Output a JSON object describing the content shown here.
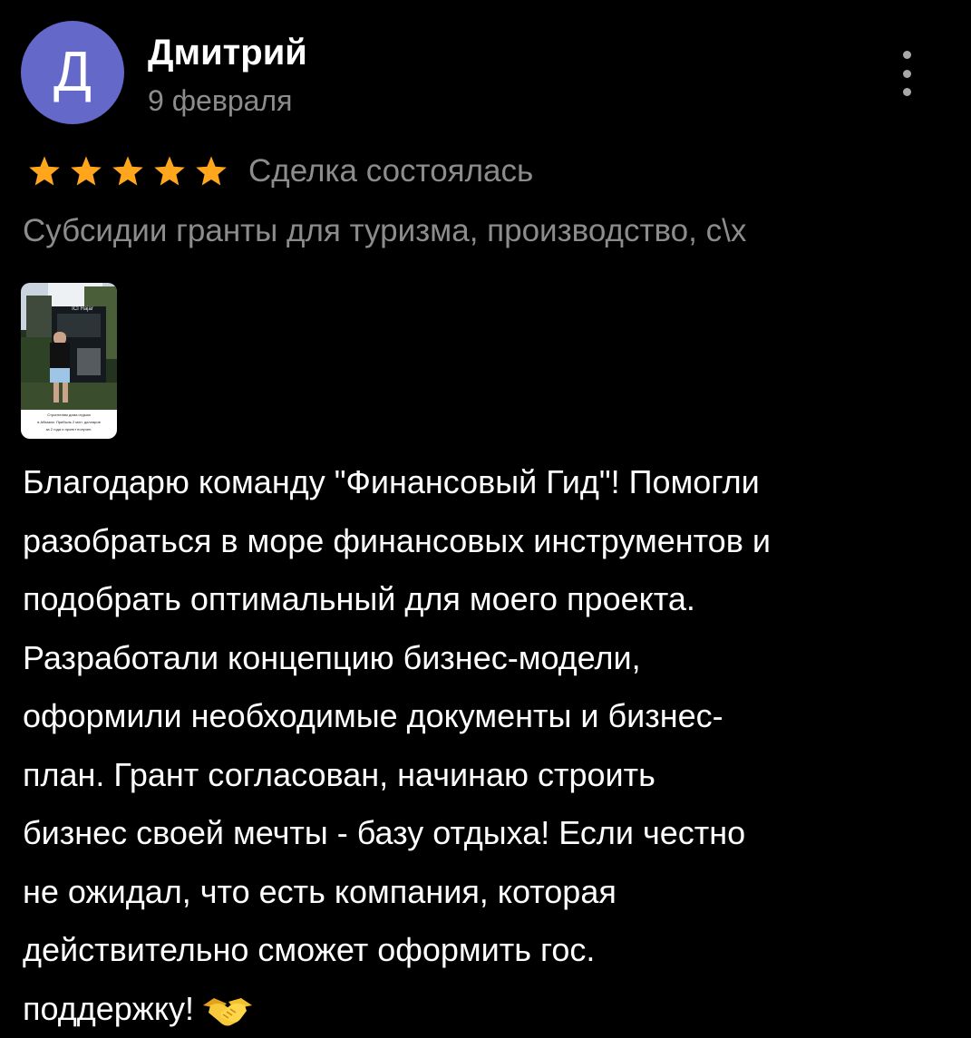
{
  "review": {
    "author": {
      "initial": "Д",
      "name": "Дмитрий",
      "avatar_color": "#6468c8"
    },
    "date": "9 февраля",
    "rating": {
      "stars": 5,
      "max": 5,
      "star_color": "#ffa61c"
    },
    "deal_status": "Сделка состоялась",
    "service_title": "Субсидии гранты для туризма, производство, с\\х",
    "photo": {
      "caption_lines": [
        "Строителям дома отдыха",
        "в Абхазии. Прибыль 2 млн. долларов",
        "за 2 года и проект получен."
      ],
      "sign_text": "ICI Hajar"
    },
    "text_lines": [
      "Благодарю команду \"Финансовый Гид\"! Помогли",
      "разобраться в море финансовых инструментов и",
      "подобрать оптимальный для моего проекта.",
      "Разработали концепцию бизнес-модели,",
      "оформили необходимые документы и бизнес-",
      "план. Грант  согласован, начинаю строить",
      "бизнес своей мечты - базу отдыха! Если честно",
      "не ожидал, что есть компания, которая",
      "действительно сможет оформить гос.",
      "поддержку!"
    ],
    "end_emoji": "handshake-icon"
  },
  "icons": {
    "more": "more-vertical-icon",
    "star": "star-icon"
  },
  "colors": {
    "background": "#000000",
    "primary_text": "#ffffff",
    "secondary_text": "#8c8c8c"
  }
}
